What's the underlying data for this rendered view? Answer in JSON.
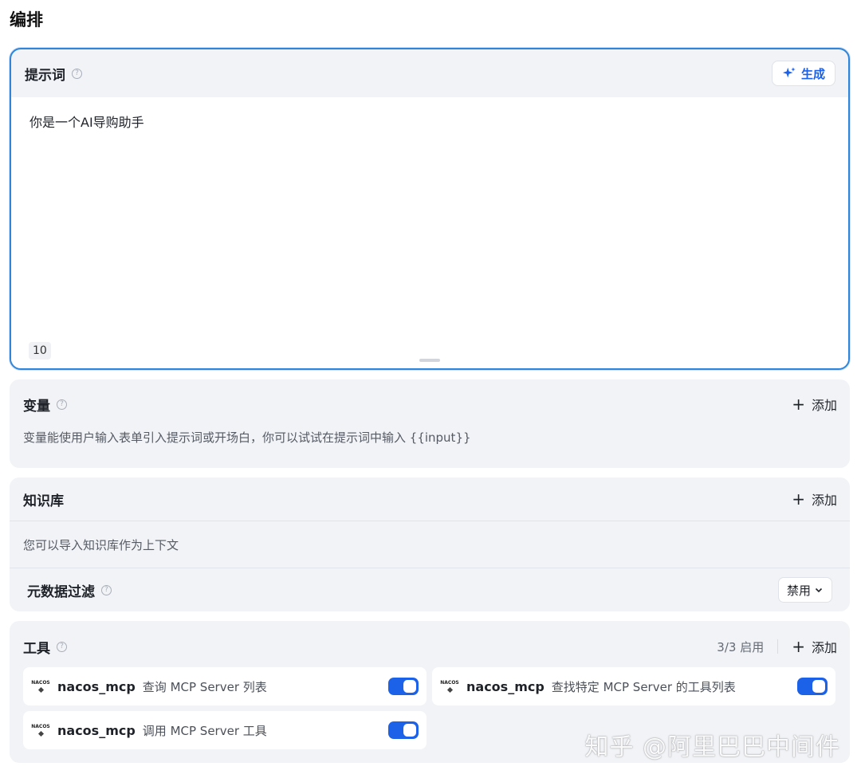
{
  "page": {
    "heading": "编排"
  },
  "prompt": {
    "title": "提示词",
    "help_icon": "question-circle-icon",
    "generate_label": "生成",
    "content": "你是一个AI导购助手",
    "char_count": "10"
  },
  "variables": {
    "title": "变量",
    "add_label": "添加",
    "description": "变量能使用户输入表单引入提示词或开场白，你可以试试在提示词中输入 {{input}}"
  },
  "knowledge": {
    "title": "知识库",
    "add_label": "添加",
    "description": "您可以导入知识库作为上下文",
    "metadata_filter_label": "元数据过滤",
    "metadata_filter_value": "禁用"
  },
  "tools": {
    "title": "工具",
    "status": "3/3 启用",
    "add_label": "添加",
    "items": [
      {
        "name": "nacos_mcp",
        "description": "查询 MCP Server 列表",
        "enabled": true,
        "icon": "nacos-logo-icon",
        "icon_text": "NACOS"
      },
      {
        "name": "nacos_mcp",
        "description": "查找特定 MCP Server 的工具列表",
        "enabled": true,
        "icon": "nacos-logo-icon",
        "icon_text": "NACOS"
      },
      {
        "name": "nacos_mcp",
        "description": "调用 MCP Server 工具",
        "enabled": true,
        "icon": "nacos-logo-icon",
        "icon_text": "NACOS"
      }
    ]
  },
  "colors": {
    "accent": "#1c62e8",
    "prompt_border": "#2d86db",
    "card_bg": "#f1f3f7"
  },
  "watermark": "知乎 @阿里巴巴中间件"
}
